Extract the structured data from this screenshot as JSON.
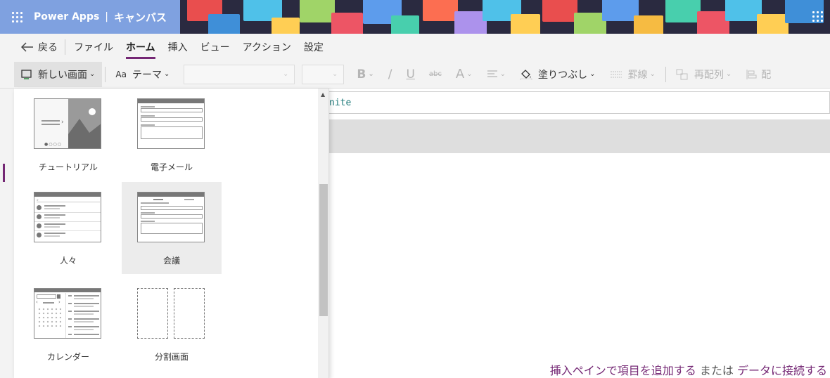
{
  "header": {
    "brand": "Power Apps",
    "separator": "|",
    "mode": "キャンバス"
  },
  "menu": {
    "back_label": "戻る",
    "items": [
      {
        "label": "ファイル"
      },
      {
        "label": "ホーム",
        "active": true
      },
      {
        "label": "挿入"
      },
      {
        "label": "ビュー"
      },
      {
        "label": "アクション"
      },
      {
        "label": "設定"
      }
    ]
  },
  "toolbar": {
    "new_screen_label": "新しい画面",
    "theme_label": "テーマ",
    "bold_label": "B",
    "italic_label": "/",
    "underline_label": "U",
    "strike_label": "abc",
    "fontsize_label": "A",
    "fill_label": "塗りつぶし",
    "border_label": "罫線",
    "arrange_label": "再配列",
    "align_label": "配"
  },
  "formula": {
    "value": "nite"
  },
  "canvas": {
    "msg_link1": "挿入ペインで項目を追加する",
    "msg_mid": "または",
    "msg_link2": "データに接続する"
  },
  "templates": [
    {
      "label": "チュートリアル"
    },
    {
      "label": "電子メール"
    },
    {
      "label": "人々"
    },
    {
      "label": "会議",
      "selected": true
    },
    {
      "label": "カレンダー"
    },
    {
      "label": "分割画面"
    }
  ],
  "colors": {
    "accent": "#742774",
    "header_left": "#7fa1e0"
  }
}
